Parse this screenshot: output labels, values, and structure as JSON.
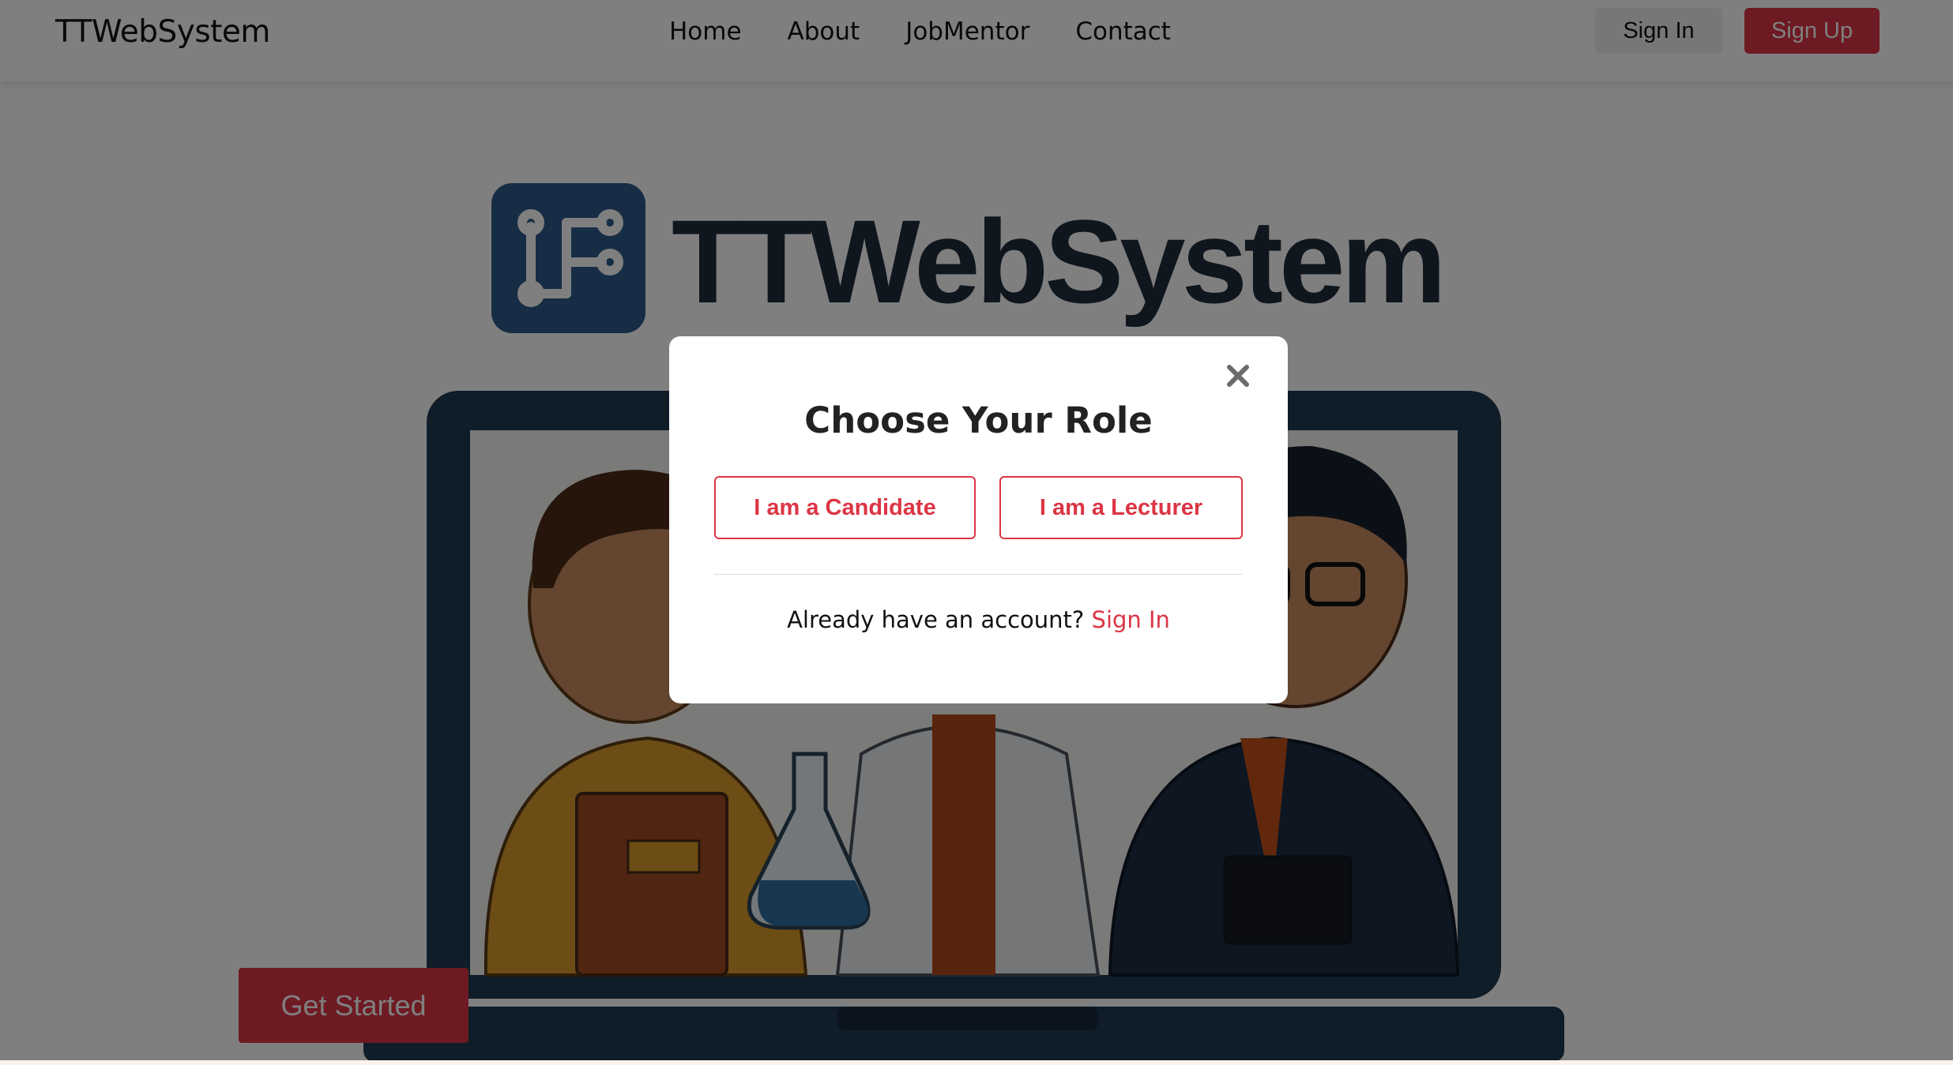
{
  "navbar": {
    "brand": "TTWebSystem",
    "links": [
      "Home",
      "About",
      "JobMentor",
      "Contact"
    ],
    "sign_in": "Sign In",
    "sign_up": "Sign Up"
  },
  "hero": {
    "logo_text": "TTWebSystem",
    "get_started": "Get Started"
  },
  "modal": {
    "title": "Choose Your Role",
    "candidate_button": "I am a Candidate",
    "lecturer_button": "I am a Lecturer",
    "footer_text": "Already have an account?",
    "footer_link": "Sign In"
  },
  "colors": {
    "accent": "#dc3545",
    "logo_blue": "#2f5b8a",
    "laptop_navy": "#1f3a52"
  },
  "icons": {
    "close": "close-icon",
    "logo": "circuit-logo-icon"
  }
}
